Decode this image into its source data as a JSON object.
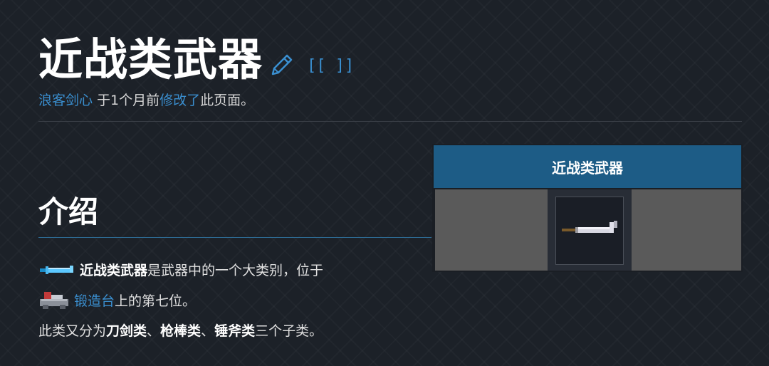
{
  "page": {
    "title": "近战类武器",
    "source_link": "[[ ]]"
  },
  "byline": {
    "author": "浪客剑心",
    "text_before": " 于1个月前",
    "action_link": "修改了",
    "text_after": "此页面。"
  },
  "infobox": {
    "header": "近战类武器",
    "image_icon": "pixel-sword-icon"
  },
  "section": {
    "title": "介绍"
  },
  "intro": {
    "line1_icon": "blue-sword-icon",
    "line1_bold": "近战类武器",
    "line1_text": " 是武器中的一个大类别，位于",
    "line2_icon": "forge-icon",
    "line2_link": "锻造台",
    "line2_text": "上的第七位。",
    "line3_text_a": "此类又分为",
    "line3_bold_a": "刀剑类",
    "line3_sep_a": "、",
    "line3_bold_b": "枪棒类",
    "line3_sep_b": "、",
    "line3_bold_c": "锤斧类",
    "line3_text_b": "三个子类。"
  },
  "colors": {
    "background": "#1c2128",
    "link": "#3a8fd0",
    "infobox_header": "#1d5c86",
    "infobox_body": "#5a5a5a"
  }
}
